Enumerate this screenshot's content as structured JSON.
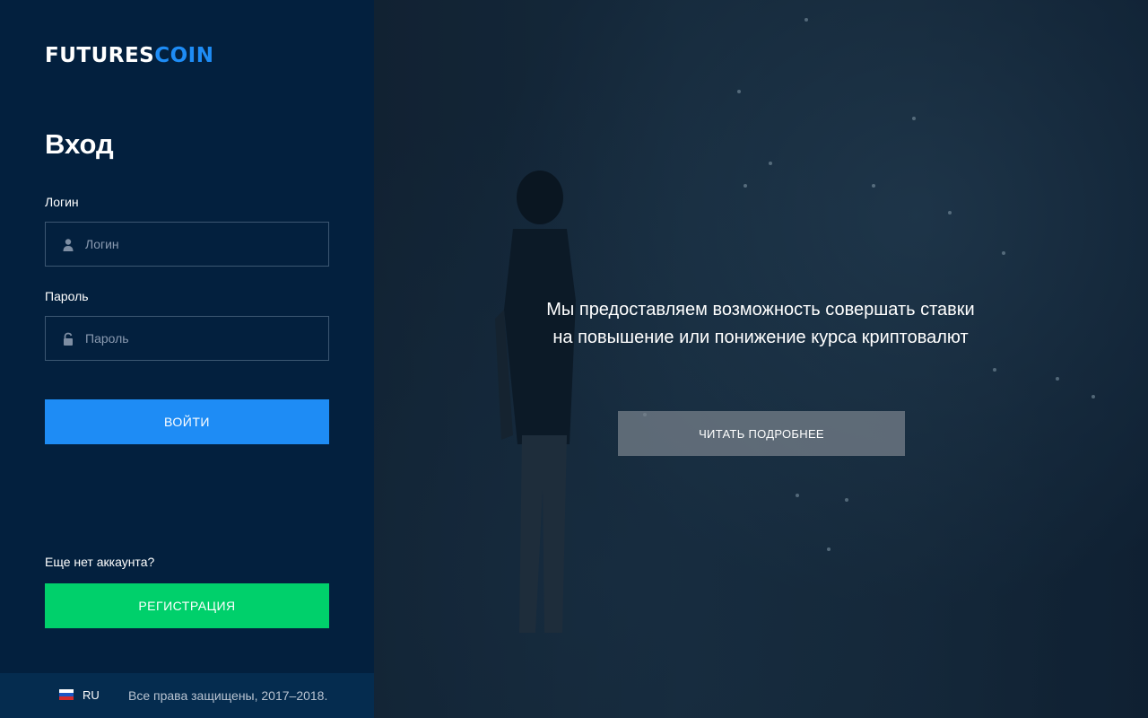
{
  "brand": {
    "part1": "FUTURES",
    "part2": "COIN",
    "accent": "#1e8cf5"
  },
  "login_form": {
    "title": "Вход",
    "login_label": "Логин",
    "login_placeholder": "Логин",
    "password_label": "Пароль",
    "password_placeholder": "Пароль",
    "submit_label": "ВОЙТИ",
    "submit_color": "#1e8cf5"
  },
  "registration": {
    "prompt": "Еще нет аккаунта?",
    "button_label": "РЕГИСТРАЦИЯ",
    "button_color": "#00d06b"
  },
  "footer": {
    "language": "RU",
    "language_icon": "russia-flag-icon",
    "copyright": "Все права защищены, 2017–2018."
  },
  "hero": {
    "tagline": "Мы предоставляем возможность совершать ставки на повышение или понижение курса криптовалют",
    "read_more_label": "ЧИТАТЬ ПОДРОБНЕЕ"
  },
  "icons": {
    "login_field": "user-icon",
    "password_field": "lock-icon"
  }
}
